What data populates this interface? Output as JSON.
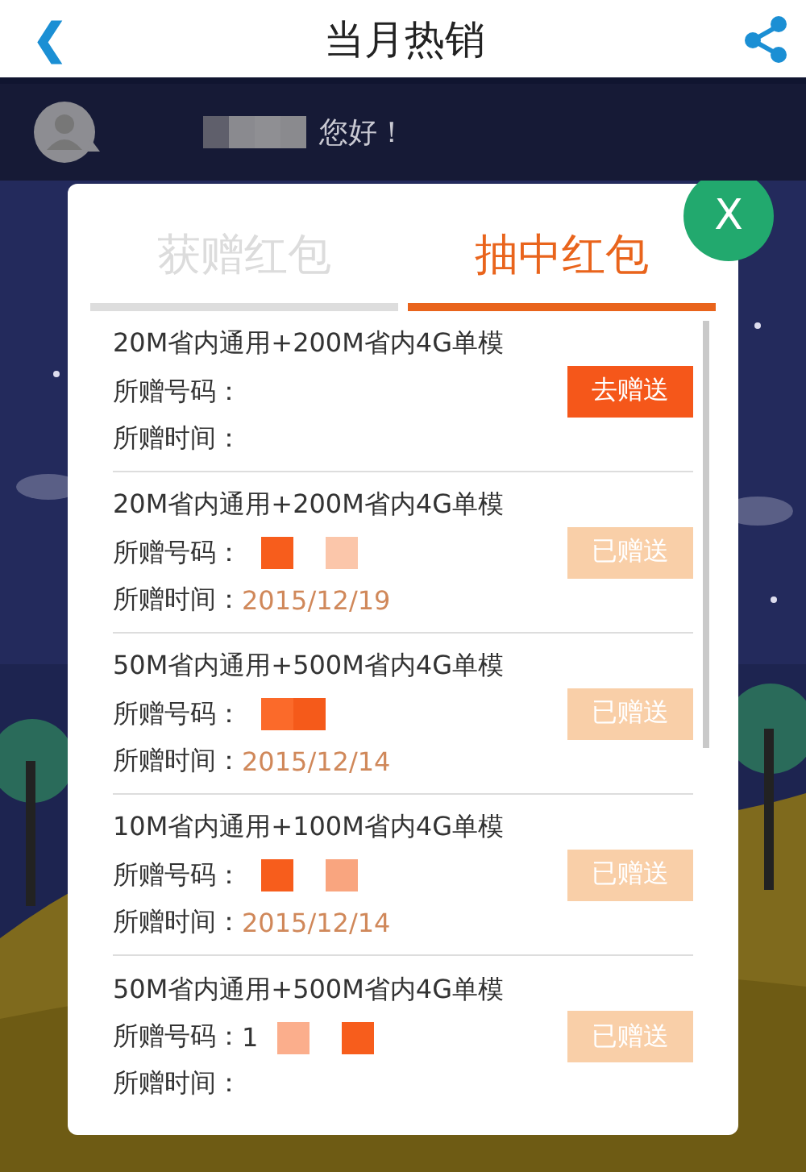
{
  "header": {
    "back": "❮",
    "title": "当月热销"
  },
  "greeting": {
    "name_masked": true,
    "text": "您好！"
  },
  "dialog": {
    "close": "X",
    "tabs": [
      {
        "label": "获赠红包",
        "selected": false
      },
      {
        "label": "抽中红包",
        "selected": true
      }
    ],
    "items": [
      {
        "title": "20M省内通用+200M省内4G单模",
        "number_label": "所赠号码：",
        "number_masked": false,
        "time_label": "所赠时间：",
        "button": {
          "label": "去赠送",
          "disabled": false
        }
      },
      {
        "title": "20M省内通用+200M省内4G单模",
        "number_label": "所赠号码：",
        "number_masked": true,
        "time_label": "所赠时间：",
        "date": "2015/12/19",
        "button": {
          "label": "已赠送",
          "disabled": true
        }
      },
      {
        "title": "50M省内通用+500M省内4G单模",
        "number_label": "所赠号码：",
        "number_masked": true,
        "time_label": "所赠时间：",
        "date": "2015/12/14",
        "button": {
          "label": "已赠送",
          "disabled": true
        }
      },
      {
        "title": "10M省内通用+100M省内4G单模",
        "number_label": "所赠号码：",
        "number_masked": true,
        "time_label": "所赠时间：",
        "date": "2015/12/14",
        "button": {
          "label": "已赠送",
          "disabled": true
        }
      },
      {
        "title": "50M省内通用+500M省内4G单模",
        "number_label": "所赠号码：",
        "number": "1",
        "number_masked": true,
        "time_label": "所赠时间：",
        "button": {
          "label": "已赠送",
          "disabled": true
        }
      }
    ]
  }
}
